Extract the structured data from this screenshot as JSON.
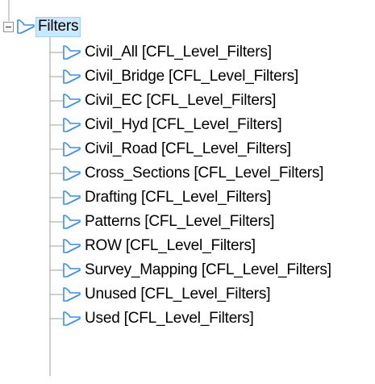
{
  "tree": {
    "root": {
      "label": "Filters",
      "expanded": true,
      "selected": true,
      "icon": "filter-folder-icon"
    },
    "children": [
      {
        "label": "Civil_All [CFL_Level_Filters]"
      },
      {
        "label": "Civil_Bridge [CFL_Level_Filters]"
      },
      {
        "label": "Civil_EC [CFL_Level_Filters]"
      },
      {
        "label": "Civil_Hyd [CFL_Level_Filters]"
      },
      {
        "label": "Civil_Road [CFL_Level_Filters]"
      },
      {
        "label": "Cross_Sections [CFL_Level_Filters]"
      },
      {
        "label": "Drafting [CFL_Level_Filters]"
      },
      {
        "label": "Patterns [CFL_Level_Filters]"
      },
      {
        "label": "ROW [CFL_Level_Filters]"
      },
      {
        "label": "Survey_Mapping [CFL_Level_Filters]"
      },
      {
        "label": "Unused [CFL_Level_Filters]"
      },
      {
        "label": "Used [CFL_Level_Filters]"
      }
    ],
    "colors": {
      "icon_stroke": "#3a8ee6",
      "icon_fill": "#ffffff",
      "selection_bg": "#cce8ff",
      "selection_border": "#99d1ff",
      "tree_line": "#a0a0a0"
    }
  }
}
